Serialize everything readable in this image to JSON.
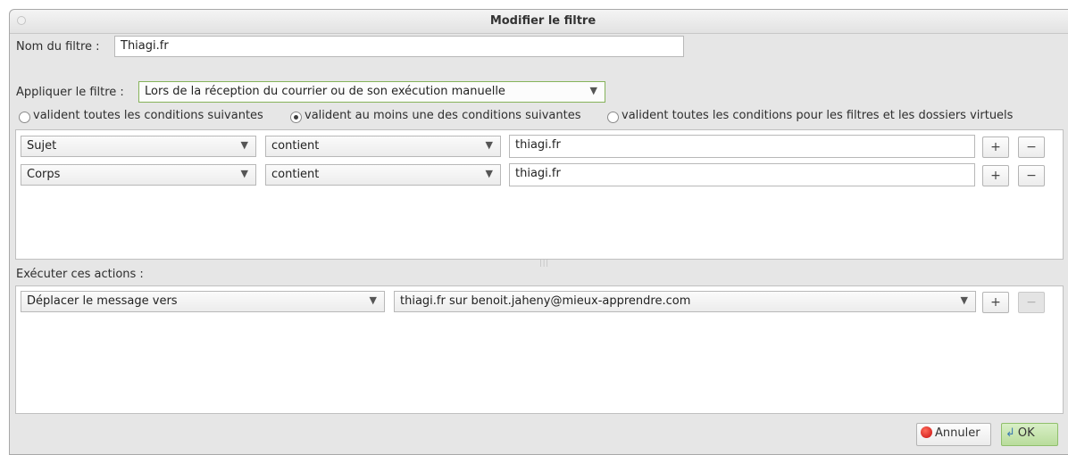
{
  "window": {
    "title": "Modifier le filtre"
  },
  "filter_name": {
    "label": "Nom du filtre :",
    "value": "Thiagi.fr"
  },
  "apply": {
    "label": "Appliquer le filtre :",
    "selected": "Lors de la réception du courrier ou de son exécution manuelle"
  },
  "match_options": [
    {
      "label": "valident toutes les conditions suivantes",
      "checked": false
    },
    {
      "label": "valident au moins une des conditions suivantes",
      "checked": true
    },
    {
      "label": "valident toutes les conditions pour les filtres et les dossiers virtuels",
      "checked": false
    }
  ],
  "conditions": [
    {
      "field": "Sujet",
      "operator": "contient",
      "value": "thiagi.fr"
    },
    {
      "field": "Corps",
      "operator": "contient",
      "value": "thiagi.fr"
    }
  ],
  "actions_label": "Exécuter ces actions :",
  "actions": [
    {
      "type": "Déplacer le message vers",
      "target": "thiagi.fr sur benoit.jaheny@mieux-apprendre.com"
    }
  ],
  "row_buttons": {
    "add": "+",
    "remove": "−"
  },
  "footer": {
    "cancel": "Annuler",
    "ok": "OK"
  }
}
